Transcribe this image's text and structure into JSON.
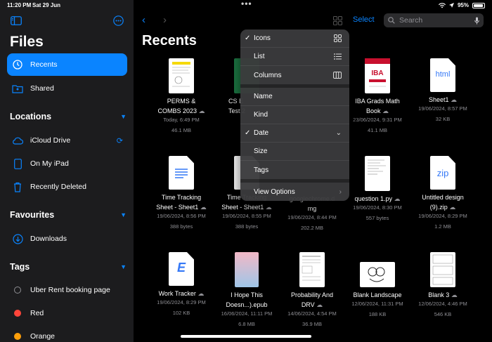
{
  "status": {
    "time": "11:20 PM",
    "date": "Sat 29 Jun",
    "battery": "95%",
    "battery_level": 0.95
  },
  "sidebar": {
    "title": "Files",
    "items": [
      {
        "label": "Recents",
        "icon": "clock-icon"
      },
      {
        "label": "Shared",
        "icon": "shared-folder-icon"
      }
    ],
    "locations": {
      "header": "Locations",
      "items": [
        {
          "label": "iCloud Drive",
          "icon": "cloud-icon"
        },
        {
          "label": "On My iPad",
          "icon": "ipad-icon"
        },
        {
          "label": "Recently Deleted",
          "icon": "trash-icon"
        }
      ]
    },
    "favourites": {
      "header": "Favourites",
      "items": [
        {
          "label": "Downloads",
          "icon": "download-icon"
        }
      ]
    },
    "tags": {
      "header": "Tags",
      "items": [
        {
          "label": "Uber Rent booking page",
          "color": "#1c1c1e"
        },
        {
          "label": "Red",
          "color": "#ff453a"
        },
        {
          "label": "Orange",
          "color": "#ff9f0a"
        }
      ]
    }
  },
  "toolbar": {
    "select_label": "Select",
    "search_placeholder": "Search"
  },
  "main": {
    "title": "Recents"
  },
  "files": [
    {
      "name1": "PERMS &",
      "name2": "COMBS 2023",
      "date": "Today, 6:49 PM",
      "size": "46.1 MB"
    },
    {
      "name1": "CS E",
      "name2": "Test 2",
      "date": "",
      "size": ""
    },
    {
      "name1": "",
      "name2": "",
      "date": "",
      "size": ""
    },
    {
      "name1": "IBA Grads Math",
      "name2": "Book",
      "date": "23/06/2024, 9:31 PM",
      "size": "41.1 MB"
    },
    {
      "name1": "Sheet1",
      "name2": "",
      "date": "19/06/2024, 8:57 PM",
      "size": "32 KB"
    },
    {
      "name1": "Time Tracking",
      "name2": "Sheet - Sheet1",
      "date": "19/06/2024, 8:56 PM",
      "size": "388 bytes"
    },
    {
      "name1": "Time Tracking",
      "name2": "Sheet - Sheet1",
      "date": "19/06/2024, 8:55 PM",
      "size": "388 bytes"
    },
    {
      "name1": "googlechrome.d",
      "name2": "mg",
      "date": "19/06/2024, 8:44 PM",
      "size": "202.2 MB"
    },
    {
      "name1": "question 1.py",
      "name2": "",
      "date": "19/06/2024, 8:30 PM",
      "size": "557 bytes"
    },
    {
      "name1": "Untitled design",
      "name2": "(9).zip",
      "date": "19/06/2024, 8:29 PM",
      "size": "1.2 MB"
    },
    {
      "name1": "Work Tracker",
      "name2": "",
      "date": "19/06/2024, 8:29 PM",
      "size": "102 KB"
    },
    {
      "name1": "I Hope This",
      "name2": "Doesn...).epub",
      "date": "16/06/2024, 11:11 PM",
      "size": "6.8 MB"
    },
    {
      "name1": "Probability And",
      "name2": "DRV",
      "date": "14/06/2024, 4:54 PM",
      "size": "36.9 MB"
    },
    {
      "name1": "Blank Landscape",
      "name2": "",
      "date": "12/06/2024, 11:31 PM",
      "size": "188 KB"
    },
    {
      "name1": "Blank 3",
      "name2": "",
      "date": "12/06/2024, 4:46 PM",
      "size": "546 KB"
    }
  ],
  "thumb_labels": {
    "html": "html",
    "zip": "zip",
    "work": "E",
    "iba": "IBA"
  },
  "menu": {
    "items": [
      {
        "label": "Icons",
        "checked": true,
        "icon": "grid-icon"
      },
      {
        "label": "List",
        "icon": "list-icon"
      },
      {
        "label": "Columns",
        "icon": "columns-icon"
      },
      {
        "label": "Name"
      },
      {
        "label": "Kind"
      },
      {
        "label": "Date",
        "checked": true,
        "icon": "chevron-down-icon"
      },
      {
        "label": "Size"
      },
      {
        "label": "Tags"
      },
      {
        "label": "View Options",
        "icon": "chevron-right-icon"
      }
    ]
  }
}
